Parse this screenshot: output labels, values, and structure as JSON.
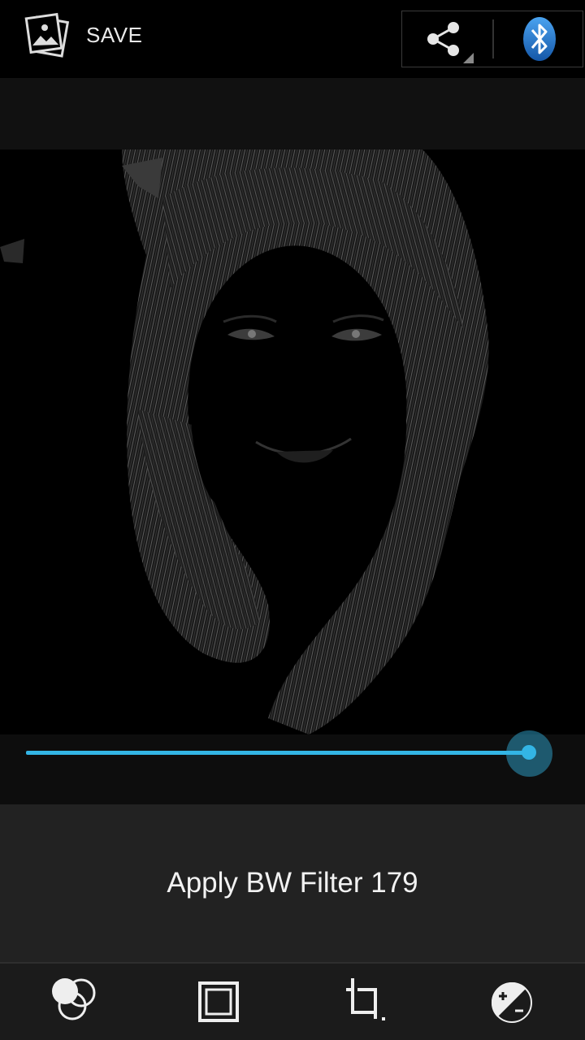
{
  "actionbar": {
    "save_label": "SAVE",
    "gallery_icon": "gallery-icon",
    "share_icon": "share-icon",
    "bluetooth_icon": "bluetooth-icon"
  },
  "editor": {
    "slider_value_fraction": 0.92,
    "filter_label": "Apply BW Filter 179"
  },
  "toolbar": {
    "items": [
      {
        "name": "filters",
        "icon": "filters-circles-icon"
      },
      {
        "name": "borders",
        "icon": "border-frame-icon"
      },
      {
        "name": "crop",
        "icon": "crop-icon"
      },
      {
        "name": "exposure",
        "icon": "exposure-icon"
      }
    ]
  },
  "colors": {
    "accent": "#33b5e5",
    "bluetooth_blue": "#1e73c8",
    "panel": "#222222"
  }
}
